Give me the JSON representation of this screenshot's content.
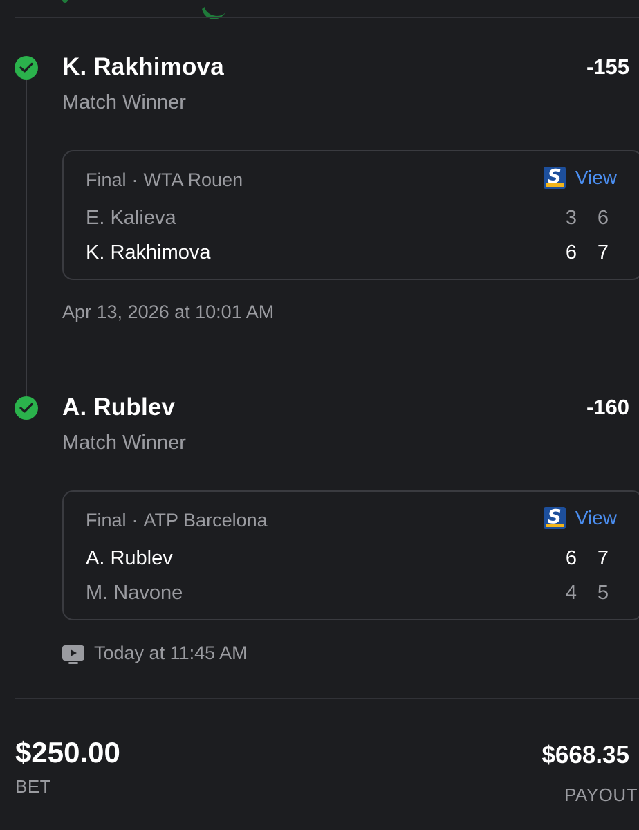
{
  "colors": {
    "background": "#1c1d20",
    "success_green": "#2bb24c",
    "link_blue": "#4b8ef0",
    "muted_text": "#9a9ba0",
    "card_border": "#3a3b40"
  },
  "legs": [
    {
      "player": "K. Rakhimova",
      "odds": "-155",
      "market": "Match Winner",
      "status_icon": "check-circle-icon",
      "card": {
        "status": "Final",
        "separator": "·",
        "tournament": "WTA Rouen",
        "view_label": "View",
        "provider_icon": "thescore-logo-icon",
        "teams": [
          {
            "name": "E. Kalieva",
            "set1": "3",
            "set2": "6",
            "winner": false
          },
          {
            "name": "K. Rakhimova",
            "set1": "6",
            "set2": "7",
            "winner": true
          }
        ]
      },
      "time": "Apr 13, 2026 at 10:01 AM"
    },
    {
      "player": "A. Rublev",
      "odds": "-160",
      "market": "Match Winner",
      "status_icon": "check-circle-icon",
      "card": {
        "status": "Final",
        "separator": "·",
        "tournament": "ATP Barcelona",
        "view_label": "View",
        "provider_icon": "thescore-logo-icon",
        "teams": [
          {
            "name": "A. Rublev",
            "set1": "6",
            "set2": "7",
            "winner": true
          },
          {
            "name": "M. Navone",
            "set1": "4",
            "set2": "5",
            "winner": false
          }
        ]
      },
      "time_icon": "tv-icon",
      "time": "Today at 11:45 AM"
    }
  ],
  "summary": {
    "bet_amount": "$250.00",
    "bet_label": "BET",
    "payout_amount": "$668.35",
    "payout_label": "PAYOUT"
  }
}
